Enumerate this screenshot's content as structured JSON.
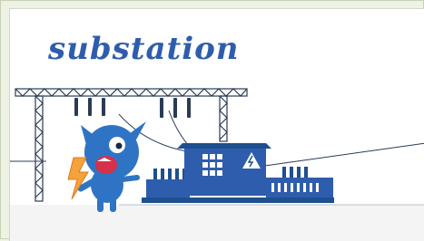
{
  "title": "substation",
  "colors": {
    "brand_blue": "#2f5dad",
    "dark_blue": "#1e4f8f",
    "monster_blue": "#2f74c4",
    "lightning": "#f4a23a",
    "ground": "#f4f4f4"
  },
  "icons": [
    "lightning-bolt",
    "high-voltage-warning"
  ]
}
